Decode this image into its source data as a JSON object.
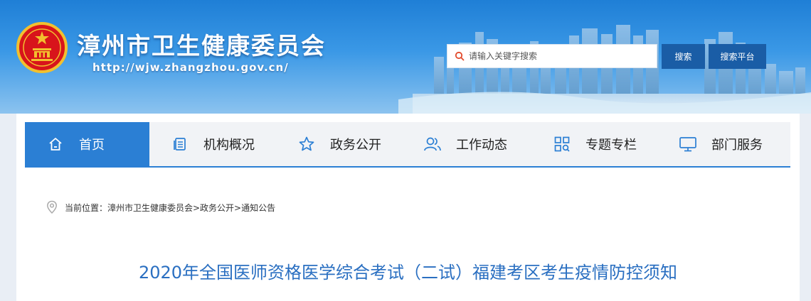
{
  "header": {
    "site_title": "漳州市卫生健康委员会",
    "site_url": "http://wjw.zhangzhou.gov.cn/",
    "search_placeholder": "请输入关键字搜索",
    "search_button": "搜索",
    "platform_button": "搜索平台"
  },
  "nav": {
    "items": [
      {
        "label": "首页",
        "icon": "home-icon"
      },
      {
        "label": "机构概况",
        "icon": "document-list-icon"
      },
      {
        "label": "政务公开",
        "icon": "star-icon"
      },
      {
        "label": "工作动态",
        "icon": "users-icon"
      },
      {
        "label": "专题专栏",
        "icon": "grid-search-icon"
      },
      {
        "label": "部门服务",
        "icon": "monitor-icon"
      }
    ],
    "active_index": 0
  },
  "breadcrumb": {
    "text": "当前位置：漳州市卫生健康委员会>政务公开>通知公告",
    "icon": "location-pin-icon"
  },
  "article": {
    "title": "2020年全国医师资格医学综合考试（二试）福建考区考生疫情防控须知"
  },
  "colors": {
    "accent": "#2b7fd4",
    "button": "#1a5da6",
    "title": "#2a6fc1"
  }
}
